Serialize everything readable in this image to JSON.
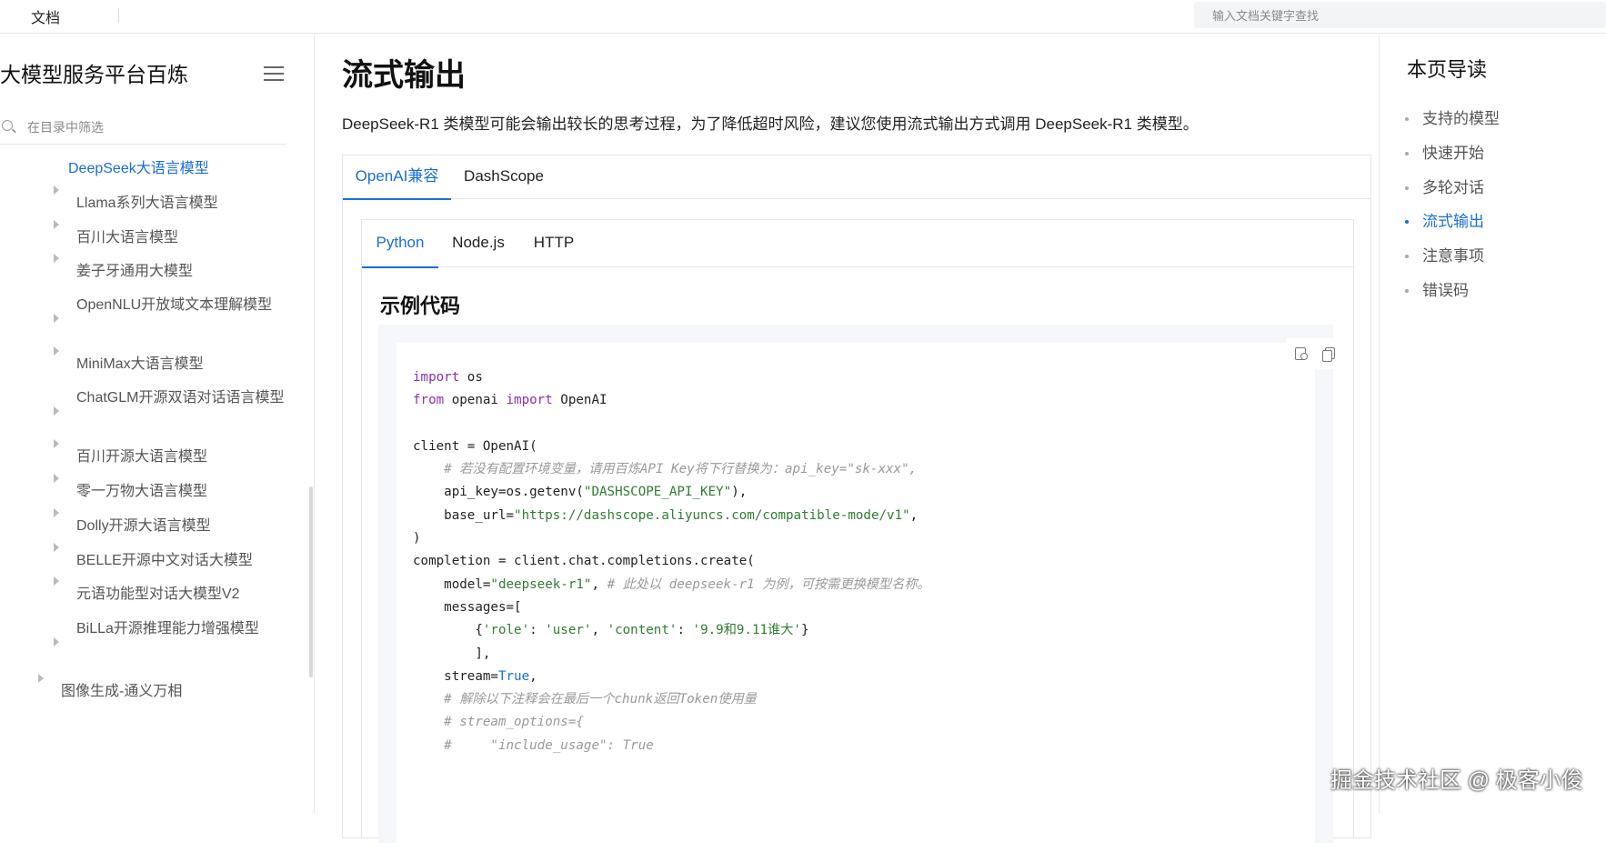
{
  "topbar": {
    "brand": "文档",
    "search_placeholder": "输入文档关键字查找"
  },
  "sidebar": {
    "title": "大模型服务平台百炼",
    "filter_placeholder": "在目录中筛选",
    "items": [
      {
        "label": "DeepSeek大语言模型",
        "active": true
      },
      {
        "label": "Llama系列大语言模型"
      },
      {
        "label": "百川大语言模型"
      },
      {
        "label": "姜子牙通用大模型"
      },
      {
        "label": "OpenNLU开放域文本理解模型"
      },
      {
        "label": "MiniMax大语言模型"
      },
      {
        "label": "ChatGLM开源双语对话语言模型"
      },
      {
        "label": "百川开源大语言模型"
      },
      {
        "label": "零一万物大语言模型"
      },
      {
        "label": "Dolly开源大语言模型"
      },
      {
        "label": "BELLE开源中文对话大模型"
      },
      {
        "label": "元语功能型对话大模型V2"
      },
      {
        "label": "BiLLa开源推理能力增强模型"
      },
      {
        "label": "图像生成-通义万相"
      }
    ]
  },
  "main": {
    "title": "流式输出",
    "intro": "DeepSeek-R1 类模型可能会输出较长的思考过程，为了降低超时风险，建议您使用流式输出方式调用 DeepSeek-R1 类模型。",
    "outer_tabs": [
      "OpenAI兼容",
      "DashScope"
    ],
    "inner_tabs": [
      "Python",
      "Node.js",
      "HTTP"
    ],
    "section_title": "示例代码"
  },
  "code": {
    "l1_kw": "import",
    "l1_rest": " os",
    "l2_kw1": "from",
    "l2_mid": " openai ",
    "l2_kw2": "import",
    "l2_rest": " OpenAI",
    "l4": "client = OpenAI(",
    "l5_cm": "    # 若没有配置环境变量，请用百炼API Key将下行替换为：api_key=\"sk-xxx\",",
    "l6_a": "    api_key=os.getenv(",
    "l6_str": "\"DASHSCOPE_API_KEY\"",
    "l6_b": "),",
    "l7_a": "    base_url=",
    "l7_str": "\"https://dashscope.aliyuncs.com/compatible-mode/v1\"",
    "l7_b": ",",
    "l8": ")",
    "l9": "completion = client.chat.completions.create(",
    "l10_a": "    model=",
    "l10_str": "\"deepseek-r1\"",
    "l10_b": ", ",
    "l10_cm": "# 此处以 deepseek-r1 为例，可按需更换模型名称。",
    "l11": "    messages=[",
    "l12_a": "        {",
    "l12_s1": "'role'",
    "l12_b": ": ",
    "l12_s2": "'user'",
    "l12_c": ", ",
    "l12_s3": "'content'",
    "l12_d": ": ",
    "l12_s4": "'9.9和9.11谁大'",
    "l12_e": "}",
    "l13": "        ],",
    "l14_a": "    stream=",
    "l14_bi": "True",
    "l14_b": ",",
    "l15_cm": "    # 解除以下注释会在最后一个chunk返回Token使用量",
    "l16_cm": "    # stream_options={",
    "l17_cm": "    #     \"include_usage\": True"
  },
  "toc": {
    "title": "本页导读",
    "items": [
      {
        "label": "支持的模型"
      },
      {
        "label": "快速开始"
      },
      {
        "label": "多轮对话"
      },
      {
        "label": "流式输出",
        "active": true
      },
      {
        "label": "注意事项"
      },
      {
        "label": "错误码"
      }
    ]
  },
  "watermark": "掘金技术社区 @ 极客小俊"
}
